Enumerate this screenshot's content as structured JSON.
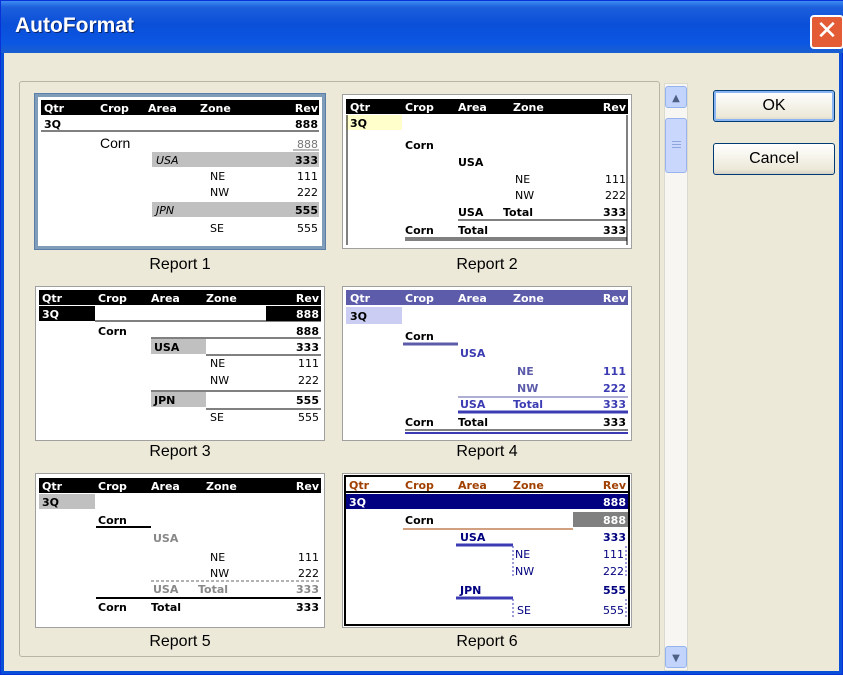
{
  "window": {
    "title": "AutoFormat",
    "close_glyph": "✕"
  },
  "buttons": {
    "ok": "OK",
    "cancel": "Cancel"
  },
  "scrollbar": {
    "up_glyph": "▲",
    "down_glyph": "▼"
  },
  "header": {
    "qtr": "Qtr",
    "crop": "Crop",
    "area": "Area",
    "zone": "Zone",
    "rev": "Rev"
  },
  "values": {
    "quarter": "3Q",
    "crop": "Corn",
    "area1": "USA",
    "area2": "JPN",
    "zone_ne": "NE",
    "zone_nw": "NW",
    "zone_se": "SE",
    "total": "Total",
    "rev_888": "888",
    "rev_333": "333",
    "rev_111": "111",
    "rev_222": "222",
    "rev_555": "555"
  },
  "reports": [
    {
      "caption": "Report 1"
    },
    {
      "caption": "Report 2"
    },
    {
      "caption": "Report 3"
    },
    {
      "caption": "Report 4"
    },
    {
      "caption": "Report 5"
    },
    {
      "caption": "Report 6"
    }
  ],
  "colors": {
    "title_bar": "#0a4fd8",
    "report4_accent": "#5c5cab",
    "report6_accent": "#000080",
    "report6_header": "#a04000"
  }
}
